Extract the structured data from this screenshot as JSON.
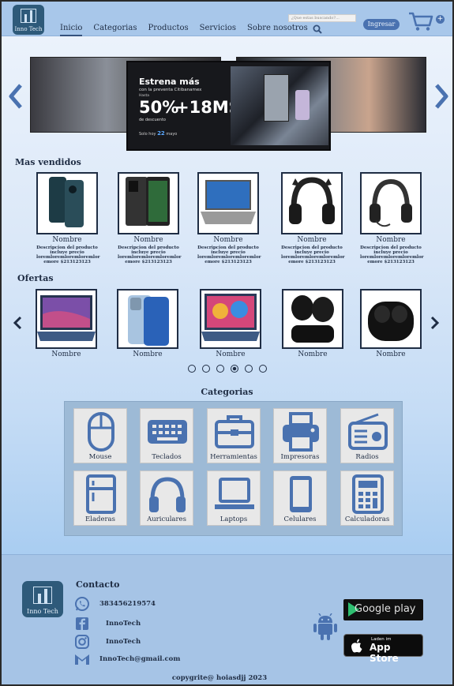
{
  "header": {
    "logo_text": "Inno Tech",
    "nav": [
      {
        "label": "Inicio",
        "active": true
      },
      {
        "label": "Categorias",
        "active": false
      },
      {
        "label": "Productos",
        "active": false
      },
      {
        "label": "Servicios",
        "active": false
      },
      {
        "label": "Sobre nosotros",
        "active": false
      }
    ],
    "search_placeholder": "¿Que estas buscando?...",
    "login_label": "Ingresar"
  },
  "hero": {
    "title": "Estrena más",
    "subtitle": "con la preventa Citibanamex",
    "hasta": "Hasta",
    "percent": "50%",
    "msi": "+18MSI",
    "descuento": "de descuento",
    "date_prefix": "Solo hoy",
    "date_day": "22",
    "date_month": "mayo"
  },
  "best_sellers": {
    "title": "Mas vendidos",
    "items": [
      {
        "name": "Nombre",
        "desc": "Descripcion del producto incluye precio loremloremloremloremlor emore $213123123"
      },
      {
        "name": "Nombre",
        "desc": "Descripcion del producto incluye precio loremloremloremloremlor emore $213123123"
      },
      {
        "name": "Nombre",
        "desc": "Descripcion del producto incluye precio loremloremloremloremlor emore $213123123"
      },
      {
        "name": "Nombre",
        "desc": "Descripcion del producto incluye precio loremloremloremloremlor emore $213123123"
      },
      {
        "name": "Nombre",
        "desc": "Descripcion del producto incluye precio loremloremloremloremlor emore $213123123"
      }
    ]
  },
  "offers": {
    "title": "Ofertas",
    "items": [
      {
        "name": "Nombre"
      },
      {
        "name": "Nombre"
      },
      {
        "name": "Nombre"
      },
      {
        "name": "Nombre"
      },
      {
        "name": "Nombre"
      }
    ],
    "active_dot": 3,
    "dot_count": 6
  },
  "categories": {
    "title": "Categorias",
    "items": [
      {
        "label": "Mouse",
        "icon": "mouse-icon"
      },
      {
        "label": "Teclados",
        "icon": "keyboard-icon"
      },
      {
        "label": "Herramientas",
        "icon": "toolbox-icon"
      },
      {
        "label": "Impresoras",
        "icon": "printer-icon"
      },
      {
        "label": "Radios",
        "icon": "radio-icon"
      },
      {
        "label": "Eladeras",
        "icon": "fridge-icon"
      },
      {
        "label": "Auriculares",
        "icon": "headphones-icon"
      },
      {
        "label": "Laptops",
        "icon": "laptop-icon"
      },
      {
        "label": "Celulares",
        "icon": "phone-icon"
      },
      {
        "label": "Calculadoras",
        "icon": "calculator-icon"
      }
    ]
  },
  "footer": {
    "logo_text": "Inno Tech",
    "contact_title": "Contacto",
    "phone": "383456219574",
    "facebook": "InnoTech",
    "instagram": "InnoTech",
    "email": "InnoTech@gmail.com",
    "google_play": "Google play",
    "app_store_small": "Laden im",
    "app_store_big": "App Store",
    "copyright": "copygrite@ hoiasdjj 2023"
  },
  "colors": {
    "accent": "#4a72b0",
    "dark_text": "#1f2d44",
    "header_bg": "#a8c7ea"
  }
}
